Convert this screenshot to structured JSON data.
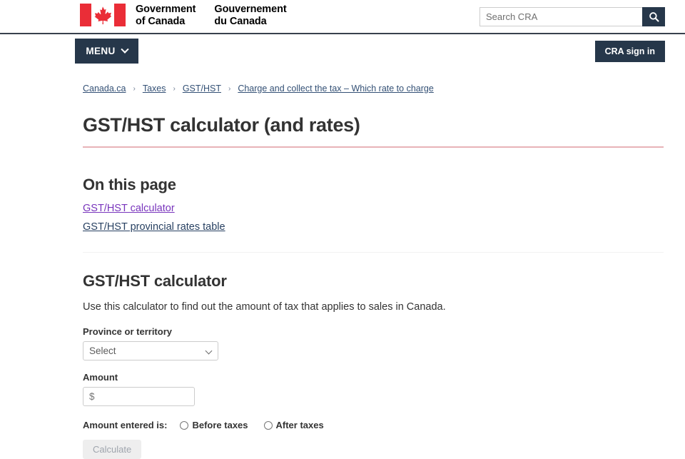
{
  "header": {
    "flag_icon": "canada-flag-icon",
    "wordmark_en_line1": "Government",
    "wordmark_en_line2": "of Canada",
    "wordmark_fr_line1": "Gouvernement",
    "wordmark_fr_line2": "du Canada",
    "search_placeholder": "Search CRA",
    "search_value": "",
    "search_icon": "search-icon"
  },
  "menu": {
    "menu_label": "MENU",
    "menu_caret_icon": "chevron-down-icon",
    "signin_label": "CRA sign in"
  },
  "breadcrumb": {
    "separator": "›",
    "items": [
      {
        "label": "Canada.ca"
      },
      {
        "label": "Taxes"
      },
      {
        "label": "GST/HST"
      },
      {
        "label": "Charge and collect the tax – Which rate to charge"
      }
    ]
  },
  "main": {
    "page_title": "GST/HST calculator (and rates)",
    "on_this_page_heading": "On this page",
    "on_this_page_links": [
      {
        "label": "GST/HST calculator",
        "state": "visited"
      },
      {
        "label": "GST/HST provincial rates table",
        "state": "normal"
      }
    ],
    "section_title": "GST/HST calculator",
    "section_lede": "Use this calculator to find out the amount of tax that applies to sales in Canada.",
    "form": {
      "province_label": "Province or territory",
      "province_selected": "Select",
      "province_caret_icon": "chevron-down-icon",
      "province_options": [
        "Select"
      ],
      "amount_label": "Amount",
      "amount_placeholder": "$",
      "amount_value": "",
      "entered_is_label": "Amount entered is:",
      "radio_before_label": "Before taxes",
      "radio_after_label": "After taxes",
      "calculate_label": "Calculate"
    }
  },
  "colors": {
    "flag_red": "#ea2d37",
    "nav_dark": "#26374a",
    "title_rule": "#e8b3b8",
    "link_visited": "#7834bc",
    "link_normal": "#284162",
    "breadcrumb_link": "#335075"
  }
}
